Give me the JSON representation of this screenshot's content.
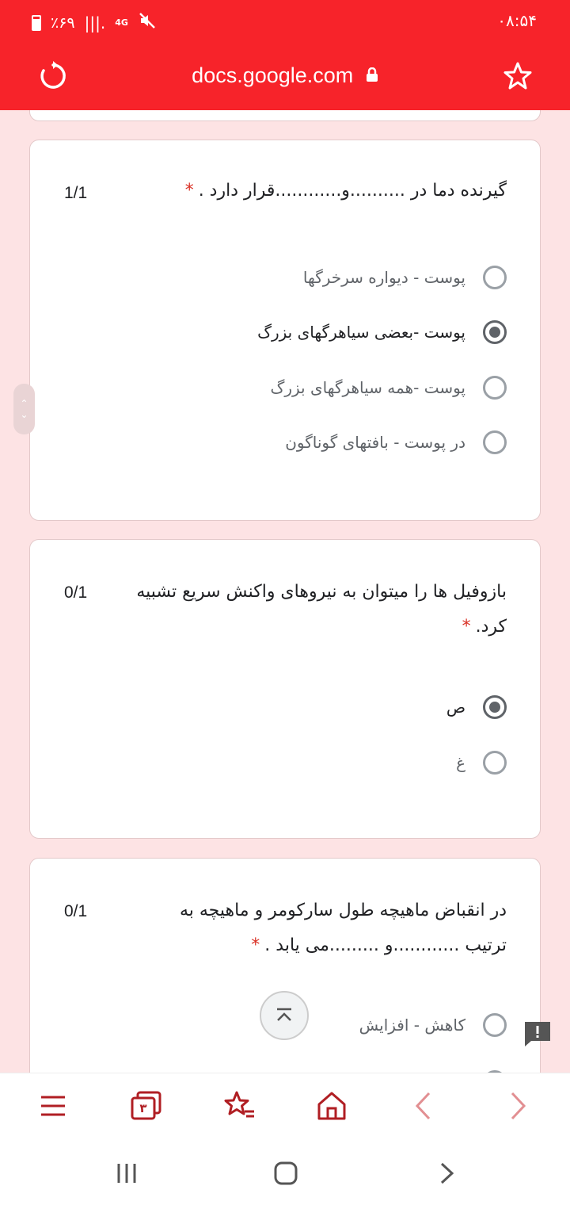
{
  "status": {
    "time": "۰۸:۵۴",
    "battery": "٪۶۹",
    "network": "4G"
  },
  "browser": {
    "url": "docs.google.com"
  },
  "questions": [
    {
      "text": "گیرنده دما در ..........و............قرار دارد .",
      "required": "*",
      "score": "1/1",
      "options": [
        {
          "label": "پوست - دیواره سرخرگها",
          "selected": false
        },
        {
          "label": "پوست -بعضی سیاهرگهای بزرگ",
          "selected": true
        },
        {
          "label": "پوست -همه سیاهرگهای بزرگ",
          "selected": false
        },
        {
          "label": "در پوست - بافتهای گوناگون",
          "selected": false
        }
      ]
    },
    {
      "text_line1": "بازوفیل ها را میتوان به نیروهای واکنش سریع تشبیه",
      "text_line2": "کرد.",
      "required": "*",
      "score": "0/1",
      "options": [
        {
          "label": "ص",
          "selected": true
        },
        {
          "label": "غ",
          "selected": false
        }
      ]
    },
    {
      "text_line1": "در انقباض ماهیچه طول سارکومر و ماهیچه به",
      "text_line2": "ترتیب ............و .........می یابد .",
      "required": "*",
      "score": "0/1",
      "options": [
        {
          "label": "کاهش - افزایش",
          "selected": false
        }
      ]
    }
  ],
  "bottom_nav": {
    "tabs_count": "۳"
  },
  "colors": {
    "accent": "#f7232a",
    "nav_icon": "#b01e23"
  }
}
